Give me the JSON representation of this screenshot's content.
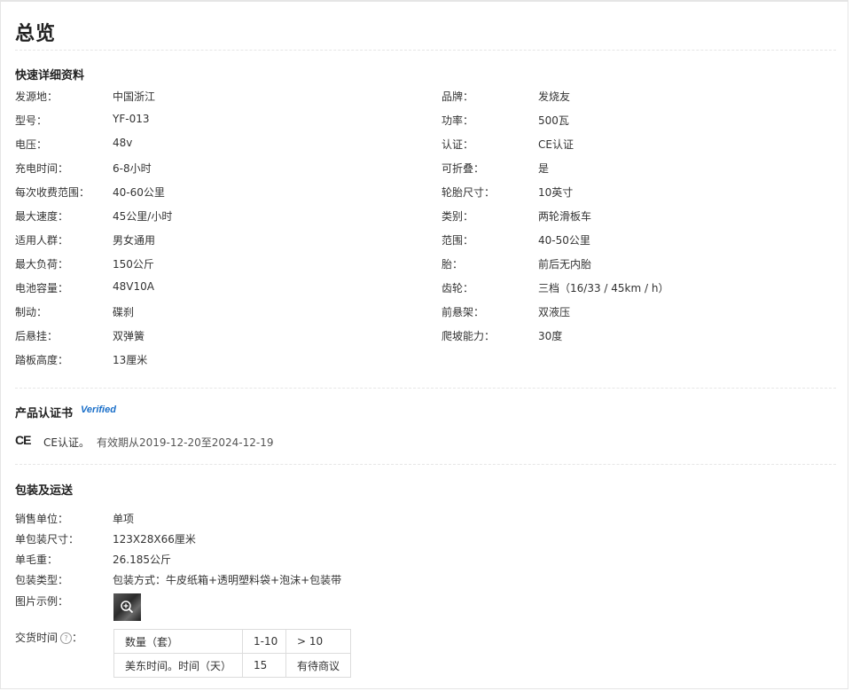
{
  "page_title": "总览",
  "quick_details": {
    "title": "快速详细资料",
    "left": [
      {
        "label": "发源地：",
        "value": "中国浙江"
      },
      {
        "label": "型号：",
        "value": "YF-013"
      },
      {
        "label": "电压：",
        "value": "48v"
      },
      {
        "label": "充电时间：",
        "value": "6-8小时"
      },
      {
        "label": "每次收费范围：",
        "value": "40-60公里"
      },
      {
        "label": "最大速度：",
        "value": "45公里/小时"
      },
      {
        "label": "适用人群：",
        "value": "男女通用"
      },
      {
        "label": "最大负荷：",
        "value": "150公斤"
      },
      {
        "label": "电池容量：",
        "value": "48V10A"
      },
      {
        "label": "制动：",
        "value": "碟刹"
      },
      {
        "label": "后悬挂：",
        "value": "双弹簧"
      },
      {
        "label": "踏板高度：",
        "value": "13厘米"
      }
    ],
    "right": [
      {
        "label": "品牌：",
        "value": "发烧友"
      },
      {
        "label": "功率：",
        "value": "500瓦"
      },
      {
        "label": "认证：",
        "value": "CE认证"
      },
      {
        "label": "可折叠：",
        "value": "是"
      },
      {
        "label": "轮胎尺寸：",
        "value": "10英寸"
      },
      {
        "label": "类别：",
        "value": "两轮滑板车"
      },
      {
        "label": "范围：",
        "value": "40-50公里"
      },
      {
        "label": "胎：",
        "value": "前后无内胎"
      },
      {
        "label": "齿轮：",
        "value": "三档（16/33 / 45km / h）"
      },
      {
        "label": "前悬架：",
        "value": "双液压"
      },
      {
        "label": "爬坡能力：",
        "value": "30度"
      }
    ]
  },
  "certificate": {
    "title": "产品认证书",
    "verified_badge": "Verified",
    "logo_text": "CE",
    "name": "CE认证。",
    "validity": "有效期从2019-12-20至2024-12-19"
  },
  "packaging": {
    "title": "包装及运送",
    "rows": [
      {
        "label": "销售单位：",
        "value": "单项"
      },
      {
        "label": "单包装尺寸：",
        "value": "123X28X66厘米"
      },
      {
        "label": "单毛重：",
        "value": "26.185公斤"
      },
      {
        "label": "包装类型：",
        "value": "包装方式：牛皮纸箱+透明塑料袋+泡沫+包装带"
      }
    ],
    "image_label": "图片示例：",
    "lead_time_label": "交货时间",
    "lead_time_colon": "：",
    "lead_table": {
      "header": [
        "数量（套）",
        "1-10",
        "> 10"
      ],
      "row": [
        "美东时间。时间（天）",
        "15",
        "有待商议"
      ]
    }
  }
}
